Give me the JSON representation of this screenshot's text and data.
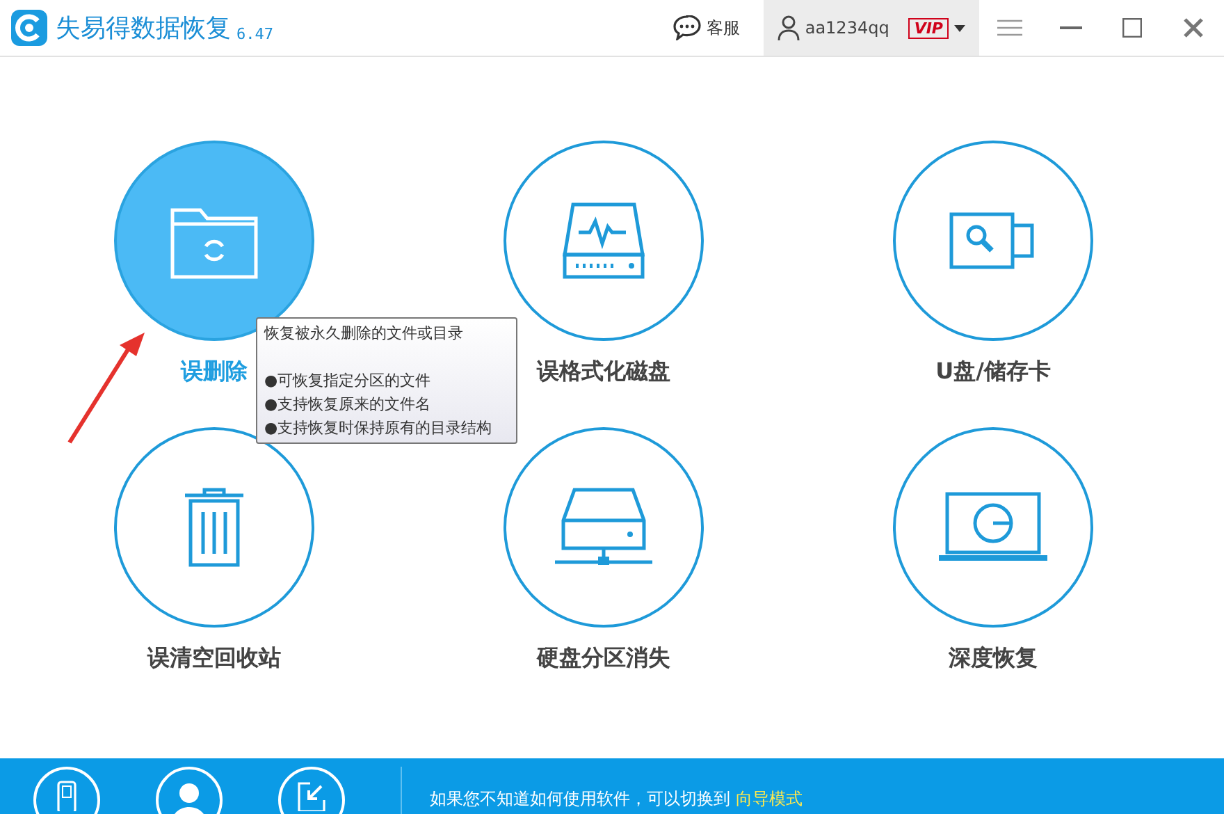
{
  "window": {
    "title": "失易得数据恢复",
    "version": "6.47"
  },
  "header": {
    "support": "客服",
    "username": "aa1234qq",
    "vip": "VIP"
  },
  "tiles": [
    {
      "label": "误删除",
      "selected": true,
      "kind": "folder"
    },
    {
      "label": "误格式化磁盘",
      "selected": false,
      "kind": "disk"
    },
    {
      "label": "U盘/储存卡",
      "selected": false,
      "kind": "usb"
    },
    {
      "label": "误清空回收站",
      "selected": false,
      "kind": "trash"
    },
    {
      "label": "硬盘分区消失",
      "selected": false,
      "kind": "drive"
    },
    {
      "label": "深度恢复",
      "selected": false,
      "kind": "monitor"
    }
  ],
  "tooltip": {
    "title": "恢复被永久删除的文件或目录",
    "bullets": [
      "●可恢复指定分区的文件",
      "●支持恢复原来的文件名",
      "●支持恢复时保持原有的目录结构"
    ]
  },
  "footer": {
    "hint": "如果您不知道如何使用软件，可以切换到",
    "link": "向导模式"
  }
}
